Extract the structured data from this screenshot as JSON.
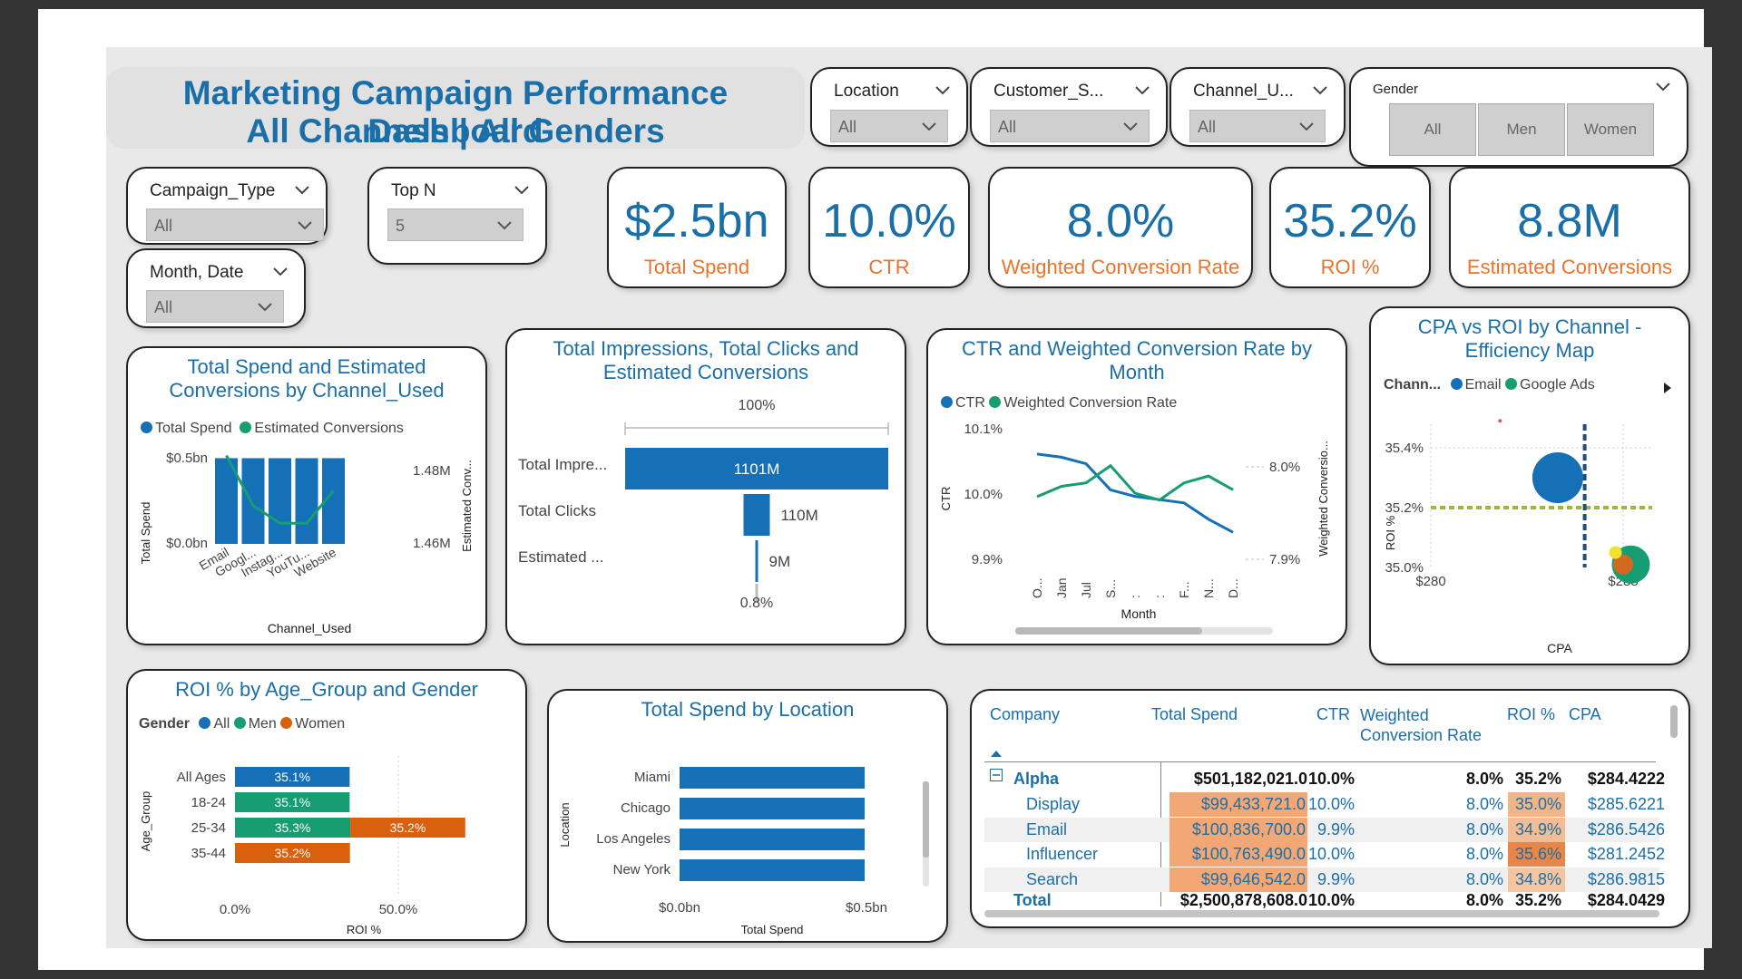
{
  "header": {
    "title_line1": "Marketing Campaign Performance Dashboard",
    "title_line2": "All Channels | All Genders"
  },
  "slicers": {
    "location": {
      "label": "Location",
      "value": "All"
    },
    "customer_segment": {
      "label": "Customer_S...",
      "value": "All"
    },
    "channel_used": {
      "label": "Channel_U...",
      "value": "All"
    },
    "gender": {
      "label": "Gender",
      "options": [
        "All",
        "Men",
        "Women"
      ]
    },
    "campaign_type": {
      "label": "Campaign_Type",
      "value": "All"
    },
    "top_n": {
      "label": "Top N",
      "value": "5"
    },
    "month_date": {
      "label": "Month, Date",
      "value": "All"
    }
  },
  "kpis": [
    {
      "value": "$2.5bn",
      "label": "Total Spend"
    },
    {
      "value": "10.0%",
      "label": "CTR"
    },
    {
      "value": "8.0%",
      "label": "Weighted Conversion Rate"
    },
    {
      "value": "35.2%",
      "label": "ROI %"
    },
    {
      "value": "8.8M",
      "label": "Estimated Conversions"
    }
  ],
  "colors": {
    "blue": "#1570b8",
    "green": "#169d72",
    "orange": "#d9600c",
    "title_blue": "#1a6fa8",
    "kpi_label": "#e8742a"
  },
  "charts": {
    "spend_conv": {
      "title": "Total Spend and Estimated Conversions by Channel_Used",
      "legend": [
        "Total Spend",
        "Estimated Conversions"
      ],
      "y_left_ticks": [
        "$0.5bn",
        "$0.0bn"
      ],
      "y_right_ticks": [
        "1.48M",
        "1.46M"
      ],
      "y_left_label": "Total Spend",
      "y_right_label": "Estimated Conv...",
      "x_label": "Channel_Used",
      "categories": [
        "Email",
        "Googl...",
        "Instag...",
        "YouTu...",
        "Website"
      ]
    },
    "funnel": {
      "title": "Total Impressions, Total Clicks and Estimated Conversions",
      "top_pct": "100%",
      "bottom_pct": "0.8%",
      "rows": [
        {
          "label": "Total Impre...",
          "value": "1101M"
        },
        {
          "label": "Total Clicks",
          "value": "110M"
        },
        {
          "label": "Estimated ...",
          "value": "9M"
        }
      ]
    },
    "ctr_month": {
      "title": "CTR and Weighted Conversion Rate by Month",
      "legend": [
        "CTR",
        "Weighted Conversion Rate"
      ],
      "y_left_ticks": [
        "10.1%",
        "10.0%",
        "9.9%"
      ],
      "y_right_ticks": [
        "8.0%",
        "7.9%"
      ],
      "y_left_label": "CTR",
      "y_right_label": "Weighted Conversio...",
      "x_label": "Month",
      "x_ticks": [
        "O...",
        "Jan",
        "Jul",
        "S...",
        ":",
        ":",
        "F...",
        "N...",
        "D..."
      ]
    },
    "cpa_roi": {
      "title": "CPA vs ROI by Channel - Efficiency Map",
      "legend_label": "Chann...",
      "legend": [
        "Email",
        "Google Ads"
      ],
      "y_ticks": [
        "35.4%",
        "35.2%",
        "35.0%"
      ],
      "x_ticks": [
        "$280",
        "$285"
      ],
      "y_label": "ROI %",
      "x_label": "CPA"
    },
    "roi_age": {
      "title": "ROI % by Age_Group and Gender",
      "legend_label": "Gender",
      "legend": [
        "All",
        "Men",
        "Women"
      ],
      "y_label": "Age_Group",
      "x_label": "ROI %",
      "x_ticks": [
        "0.0%",
        "50.0%"
      ],
      "rows": [
        {
          "group": "All Ages",
          "bars": [
            {
              "series": "All",
              "label": "35.1%",
              "value": 35.1
            }
          ]
        },
        {
          "group": "18-24",
          "bars": [
            {
              "series": "Men",
              "label": "35.1%",
              "value": 35.1
            }
          ]
        },
        {
          "group": "25-34",
          "bars": [
            {
              "series": "Men",
              "label": "35.3%",
              "value": 35.3
            },
            {
              "series": "Women",
              "label": "35.2%",
              "value": 35.2
            }
          ]
        },
        {
          "group": "35-44",
          "bars": [
            {
              "series": "Women",
              "label": "35.2%",
              "value": 35.2
            }
          ]
        }
      ]
    },
    "spend_location": {
      "title": "Total Spend by Location",
      "y_label": "Location",
      "x_label": "Total Spend",
      "x_ticks": [
        "$0.0bn",
        "$0.5bn"
      ],
      "categories": [
        "Miami",
        "Chicago",
        "Los Angeles",
        "New York"
      ]
    }
  },
  "chart_data": [
    {
      "type": "bar",
      "title": "Total Spend and Estimated Conversions by Channel_Used",
      "categories": [
        "Email",
        "Googl...",
        "Instag...",
        "YouTu...",
        "Website"
      ],
      "series": [
        {
          "name": "Total Spend",
          "type": "bar",
          "values": [
            0.5,
            0.5,
            0.5,
            0.5,
            0.5
          ],
          "unit": "$bn"
        },
        {
          "name": "Estimated Conversions",
          "type": "line",
          "values": [
            1.485,
            1.468,
            1.462,
            1.462,
            1.473
          ],
          "unit": "M"
        }
      ],
      "xlabel": "Channel_Used",
      "ylabel": "Total Spend",
      "ylim": [
        0,
        0.55
      ],
      "y2lim": [
        1.455,
        1.487
      ]
    },
    {
      "type": "bar",
      "title": "Total Impressions, Total Clicks and Estimated Conversions",
      "categories": [
        "Total Impre...",
        "Total Clicks",
        "Estimated ..."
      ],
      "values": [
        1101,
        110,
        9
      ]
    },
    {
      "type": "line",
      "title": "CTR and Weighted Conversion Rate by Month",
      "x": [
        "O...",
        "Jan",
        "Jul",
        "S...",
        ":",
        ":",
        "F...",
        "N...",
        "D..."
      ],
      "series": [
        {
          "name": "CTR",
          "values": [
            10.06,
            10.055,
            10.045,
            10.005,
            9.995,
            9.99,
            9.985,
            9.96,
            9.94
          ]
        },
        {
          "name": "Weighted Conversion Rate",
          "values": [
            7.99,
            8.005,
            8.01,
            8.035,
            7.995,
            7.985,
            8.01,
            8.02,
            8.0
          ]
        }
      ],
      "xlabel": "Month",
      "ylabel": "CTR",
      "ylim": [
        9.9,
        10.1
      ],
      "y2lim": [
        7.9,
        8.0
      ]
    },
    {
      "type": "scatter",
      "title": "CPA vs ROI by Channel - Efficiency Map",
      "series": [
        {
          "name": "Email",
          "points": [
            {
              "x": 283.3,
              "y": 35.3
            }
          ]
        },
        {
          "name": "Google Ads",
          "points": [
            {
              "x": 285.2,
              "y": 35.01
            }
          ]
        },
        {
          "name": "",
          "points": [
            {
              "x": 285.0,
              "y": 35.01
            },
            {
              "x": 284.8,
              "y": 35.05
            },
            {
              "x": 281.8,
              "y": 35.49
            }
          ]
        }
      ],
      "xlabel": "CPA",
      "ylabel": "ROI %",
      "xlim": [
        280,
        286.5
      ],
      "ylim": [
        35.0,
        35.55
      ],
      "reference_lines": {
        "x": 284.0,
        "y": 35.2
      }
    },
    {
      "type": "bar",
      "title": "ROI % by Age_Group and Gender",
      "categories": [
        "All Ages",
        "18-24",
        "25-34",
        "35-44"
      ],
      "series": [
        {
          "name": "All",
          "values": [
            35.1,
            null,
            null,
            null
          ]
        },
        {
          "name": "Men",
          "values": [
            null,
            35.1,
            35.3,
            null
          ]
        },
        {
          "name": "Women",
          "values": [
            null,
            null,
            35.2,
            35.2
          ]
        }
      ],
      "xlabel": "ROI %",
      "ylabel": "Age_Group",
      "xlim": [
        0,
        70
      ]
    },
    {
      "type": "bar",
      "title": "Total Spend by Location",
      "categories": [
        "Miami",
        "Chicago",
        "Los Angeles",
        "New York"
      ],
      "values": [
        0.5,
        0.5,
        0.5,
        0.5
      ],
      "xlabel": "Total Spend",
      "ylabel": "Location",
      "xlim": [
        0,
        0.5
      ]
    }
  ],
  "table": {
    "headers": [
      "Company",
      "Total Spend",
      "CTR",
      "Weighted Conversion Rate",
      "ROI %",
      "CPA"
    ],
    "group": {
      "name": "Alpha",
      "spend": "$501,182,021.0",
      "ctr": "10.0%",
      "wcr": "8.0%",
      "roi": "35.2%",
      "cpa": "$284.4222"
    },
    "rows": [
      {
        "name": "Display",
        "spend": "$99,433,721.0",
        "ctr": "10.0%",
        "wcr": "8.0%",
        "roi": "35.0%",
        "cpa": "$285.6221"
      },
      {
        "name": "Email",
        "spend": "$100,836,700.0",
        "ctr": "9.9%",
        "wcr": "8.0%",
        "roi": "34.9%",
        "cpa": "$286.5426"
      },
      {
        "name": "Influencer",
        "spend": "$100,763,490.0",
        "ctr": "10.0%",
        "wcr": "8.0%",
        "roi": "35.6%",
        "cpa": "$281.2452"
      },
      {
        "name": "Search",
        "spend": "$99,646,542.0",
        "ctr": "9.9%",
        "wcr": "8.0%",
        "roi": "34.8%",
        "cpa": "$286.9815"
      }
    ],
    "total": {
      "name": "Total",
      "spend": "$2,500,878,608.0",
      "ctr": "10.0%",
      "wcr": "8.0%",
      "roi": "35.2%",
      "cpa": "$284.0429"
    }
  }
}
